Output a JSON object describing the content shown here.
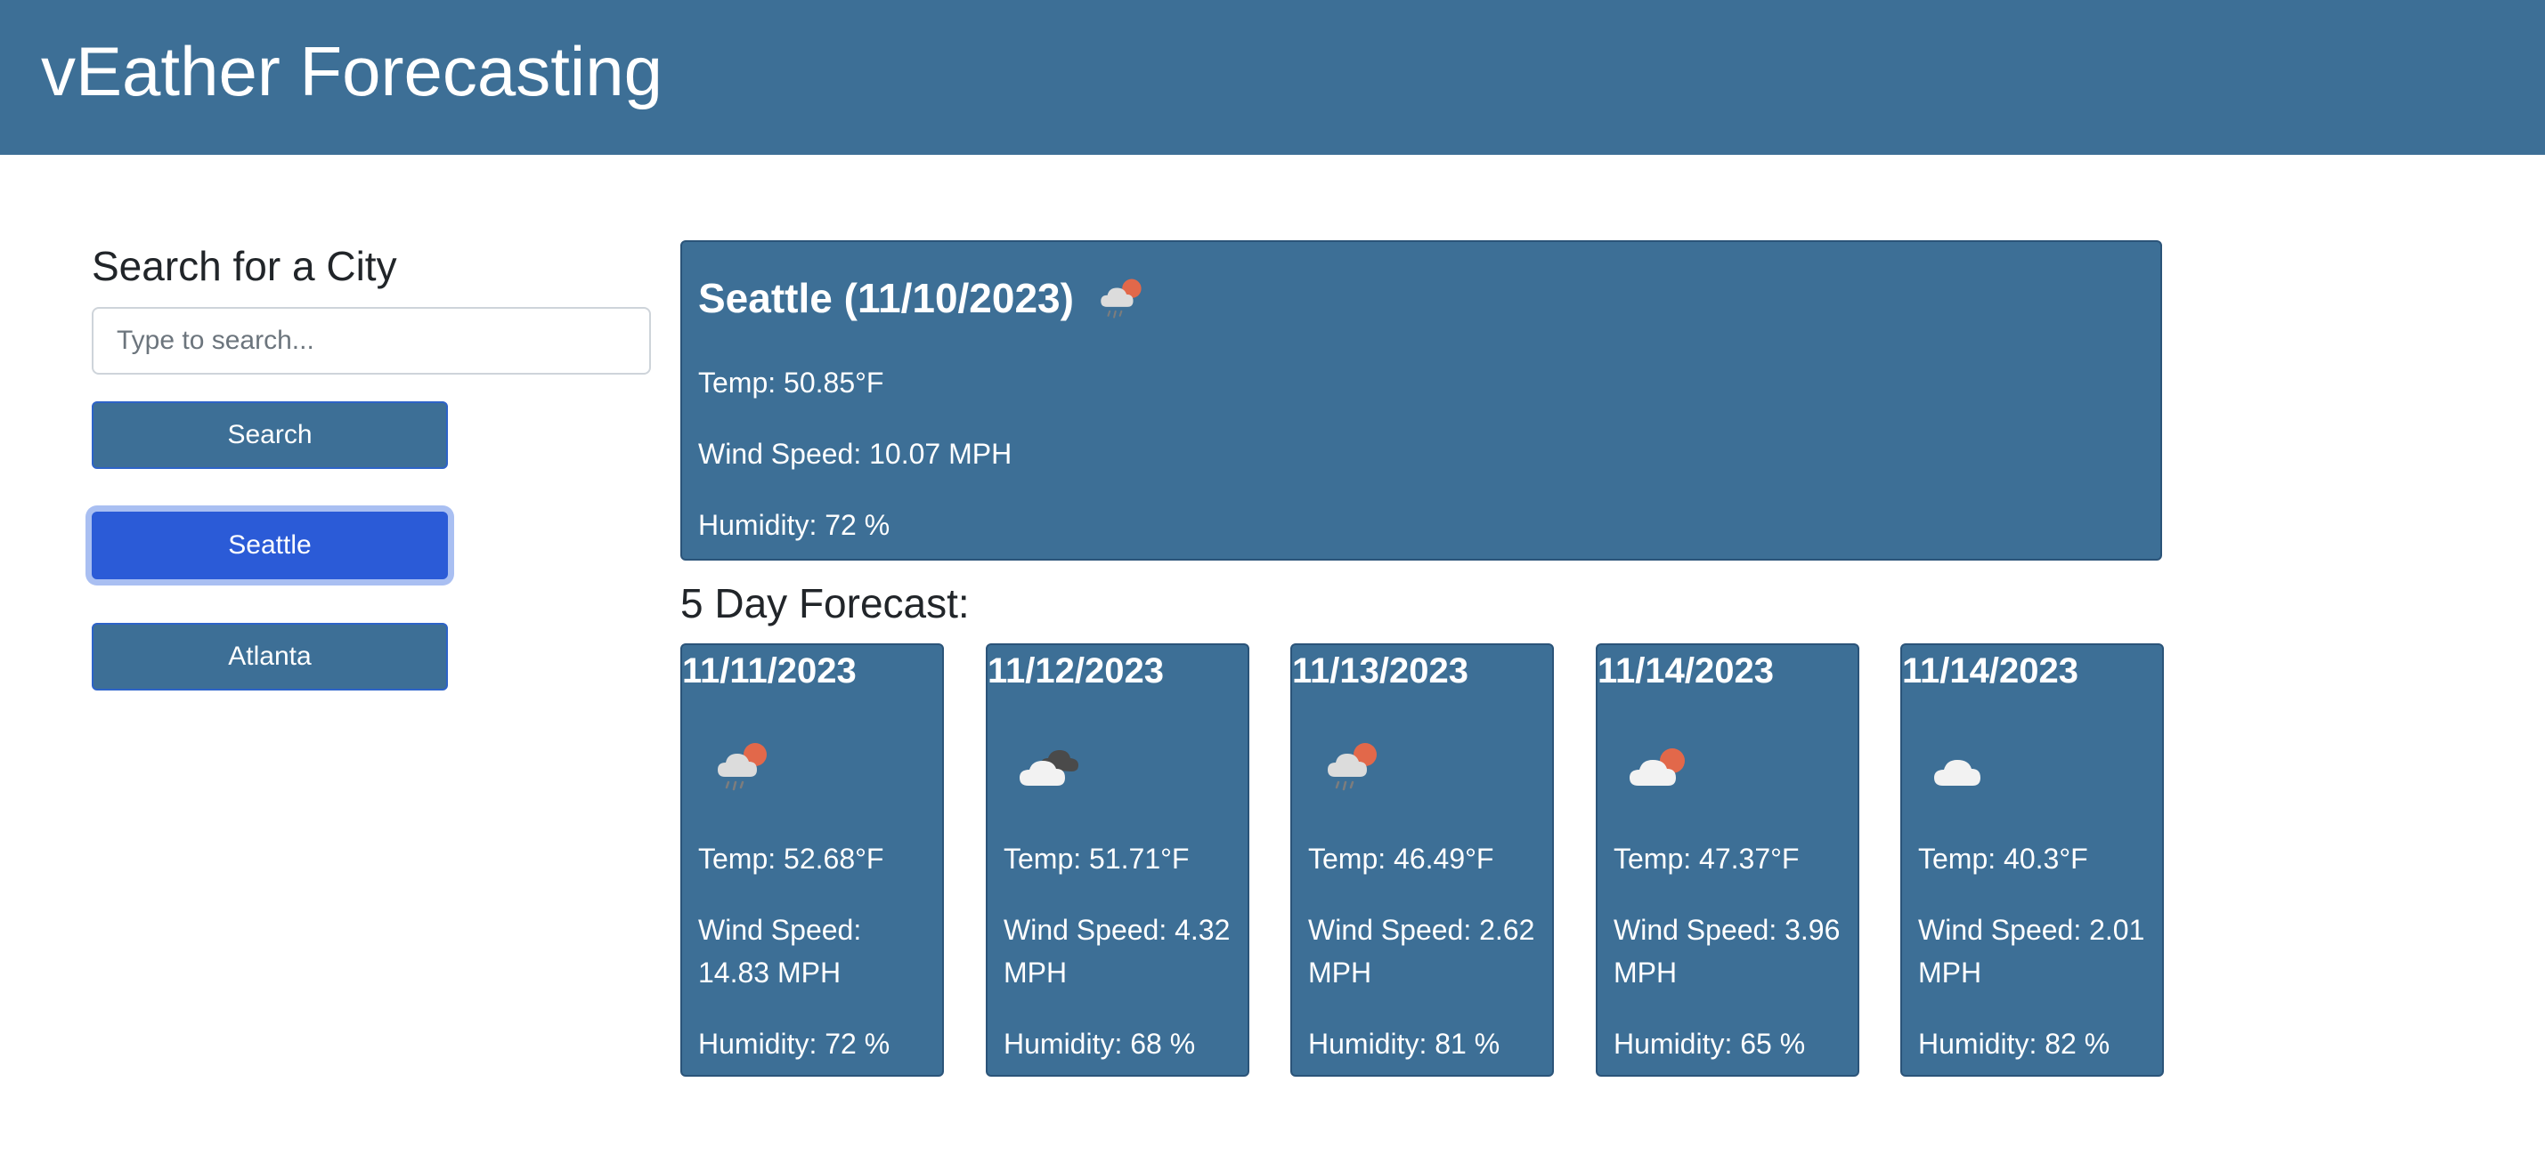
{
  "app": {
    "title": "vEather Forecasting"
  },
  "sidebar": {
    "heading": "Search for a City",
    "search_placeholder": "Type to search...",
    "search_button": "Search",
    "history": [
      {
        "label": "Seattle",
        "active": true
      },
      {
        "label": "Atlanta",
        "active": false
      }
    ]
  },
  "current": {
    "title": "Seattle (11/10/2023)",
    "icon": "cloud-rain-sun-icon",
    "temp": "Temp: 50.85°F",
    "wind": "Wind Speed: 10.07 MPH",
    "humidity": "Humidity: 72 %"
  },
  "forecast": {
    "heading": "5 Day Forecast:",
    "days": [
      {
        "date": "11/11/2023",
        "icon": "cloud-rain-sun-icon",
        "temp": "Temp: 52.68°F",
        "wind": "Wind Speed: 14.83 MPH",
        "humidity": "Humidity: 72 %"
      },
      {
        "date": "11/12/2023",
        "icon": "broken-clouds-icon",
        "temp": "Temp: 51.71°F",
        "wind": "Wind Speed: 4.32 MPH",
        "humidity": "Humidity: 68 %"
      },
      {
        "date": "11/13/2023",
        "icon": "cloud-rain-sun-icon",
        "temp": "Temp: 46.49°F",
        "wind": "Wind Speed: 2.62 MPH",
        "humidity": "Humidity: 81 %"
      },
      {
        "date": "11/14/2023",
        "icon": "cloud-sun-icon",
        "temp": "Temp: 47.37°F",
        "wind": "Wind Speed: 3.96 MPH",
        "humidity": "Humidity: 65 %"
      },
      {
        "date": "11/14/2023",
        "icon": "cloud-icon",
        "temp": "Temp: 40.3°F",
        "wind": "Wind Speed: 2.01 MPH",
        "humidity": "Humidity: 82 %"
      }
    ]
  },
  "colors": {
    "primary": "#3d6f96",
    "active_button": "#2b5bd7",
    "sun": "#e2684a"
  }
}
